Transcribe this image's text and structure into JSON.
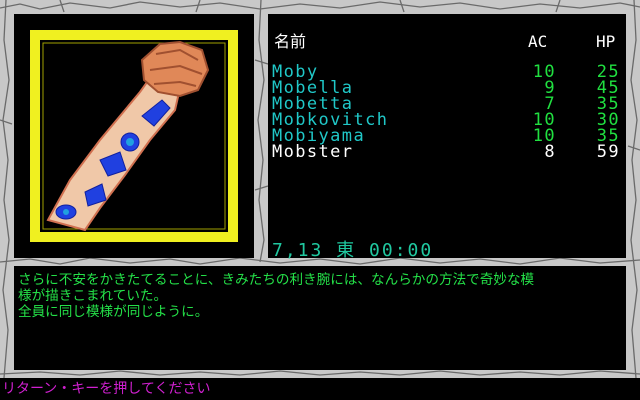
{
  "colors": {
    "stone": "#c8c8c8",
    "crack": "#6a6a6a",
    "portrait_border": "#f0f020",
    "party_active": "#20c8c8",
    "party_inactive": "#ffffff",
    "stat_color": "#20e040",
    "status_color": "#20c8a0",
    "message_color": "#24e048",
    "prompt_color": "#d020d0"
  },
  "portrait": {
    "subject": "tattooed-forearm-with-blue-glyphs"
  },
  "party": {
    "headers": {
      "name": "名前",
      "ac": "AC",
      "hp": "HP"
    },
    "members": [
      {
        "name": "Moby",
        "ac": "10",
        "hp": "25",
        "active": true
      },
      {
        "name": "Mobella",
        "ac": "9",
        "hp": "45",
        "active": true
      },
      {
        "name": "Mobetta",
        "ac": "7",
        "hp": "35",
        "active": true
      },
      {
        "name": "Mobkovitch",
        "ac": "10",
        "hp": "30",
        "active": true
      },
      {
        "name": "Mobiyama",
        "ac": "10",
        "hp": "35",
        "active": true
      },
      {
        "name": "Mobster",
        "ac": "8",
        "hp": "59",
        "active": false
      }
    ]
  },
  "status": {
    "text": "7,13 東 00:00"
  },
  "message": {
    "lines": [
      "さらに不安をかきたてることに、きみたちの利き腕には、なんらかの方法で奇妙な模",
      "様が描きこまれていた。",
      "全員に同じ模様が同じように。"
    ]
  },
  "prompt": {
    "text": "リターン・キーを押してください"
  }
}
